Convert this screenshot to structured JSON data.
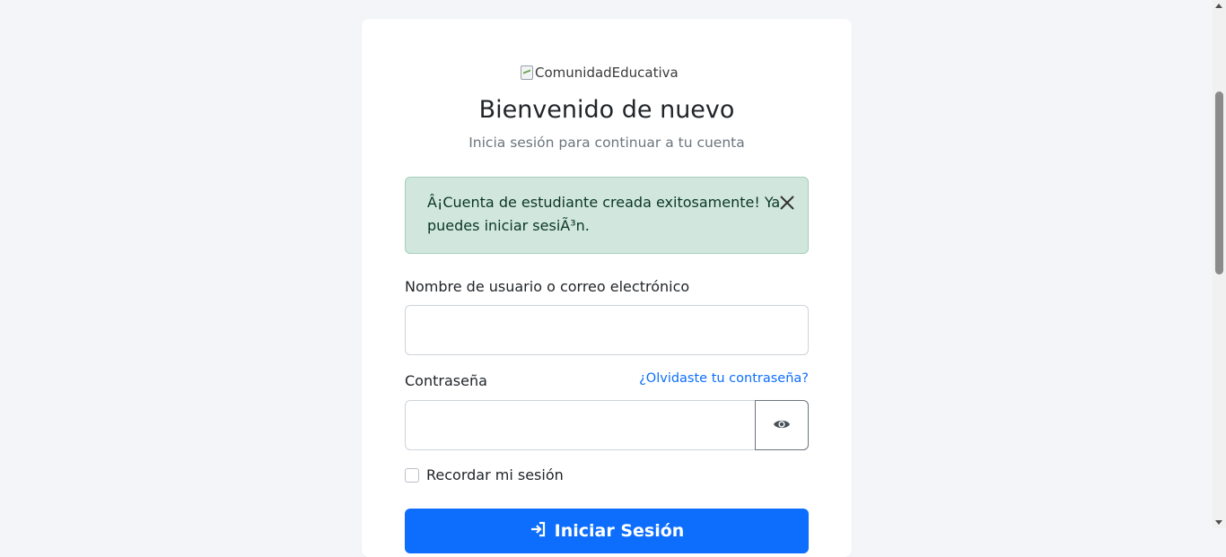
{
  "brand": {
    "logo_alt": "ComunidadEducativa"
  },
  "header": {
    "title": "Bienvenido de nuevo",
    "subtitle": "Inicia sesión para continuar a tu cuenta"
  },
  "alert": {
    "message": "Â¡Cuenta de estudiante creada exitosamente! Ya puedes iniciar sesiÃ³n.",
    "color_bg": "#d1e7dd",
    "color_text": "#0a3622"
  },
  "form": {
    "username_label": "Nombre de usuario o correo electrónico",
    "username_value": "",
    "password_label": "Contraseña",
    "password_value": "",
    "forgot_link": "¿Olvidaste tu contraseña?",
    "remember_label": "Recordar mi sesión",
    "remember_checked": false,
    "submit_label": "Iniciar Sesión"
  },
  "icons": [
    "broken-image-icon",
    "close-icon",
    "eye-icon",
    "sign-in-icon"
  ],
  "colors": {
    "accent": "#0d6efd",
    "page_bg": "#f4f5f9"
  }
}
